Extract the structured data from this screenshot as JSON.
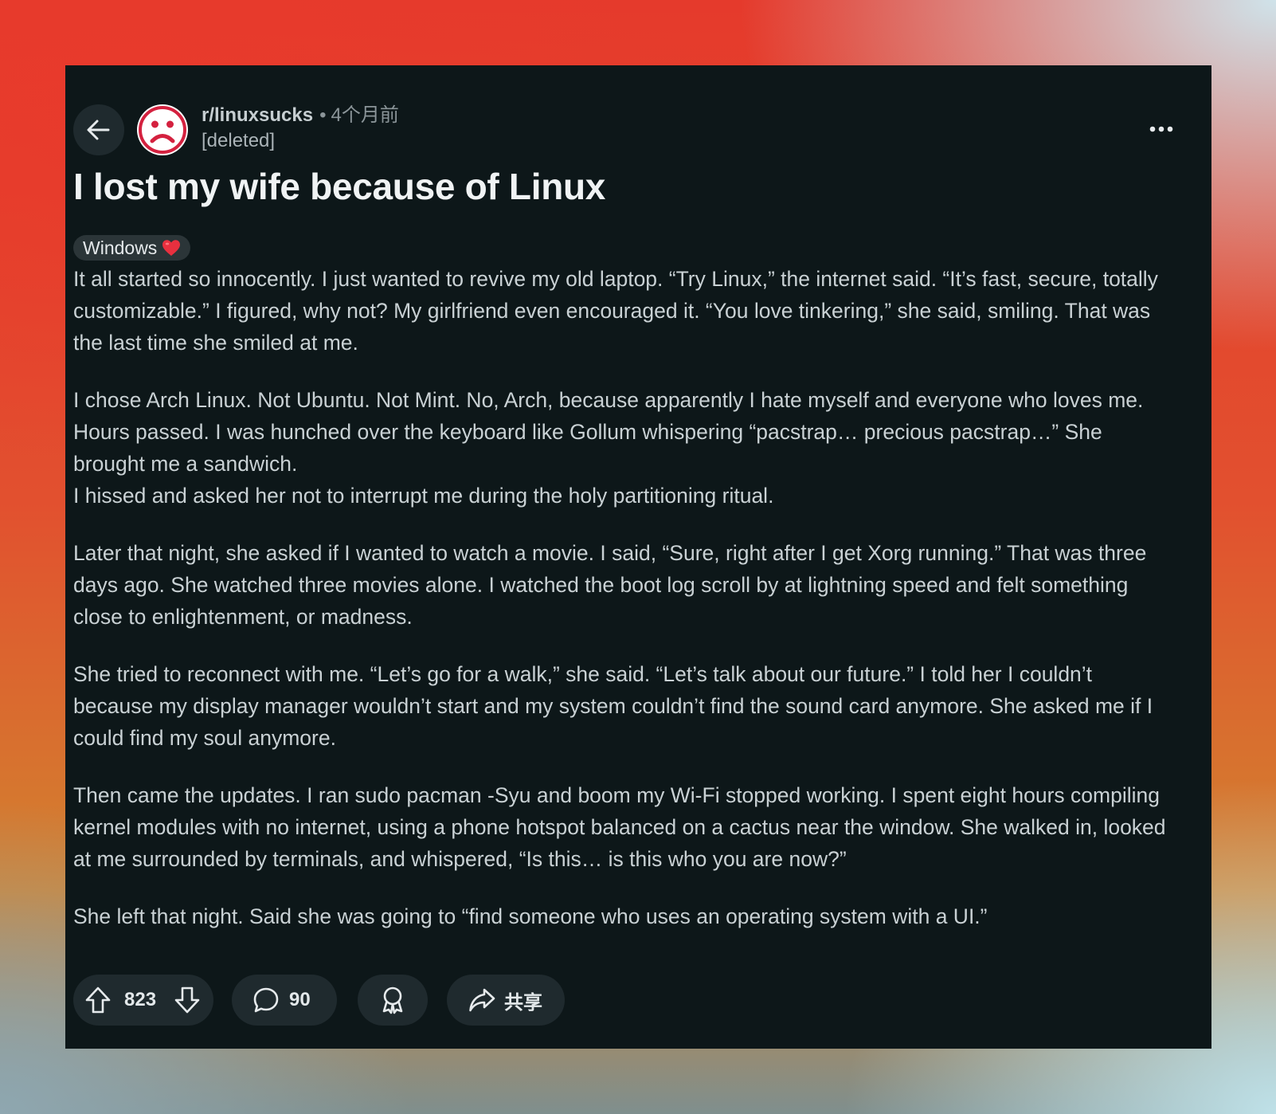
{
  "post": {
    "subreddit": "r/linuxsucks",
    "separator": "•",
    "time_ago": "4个月前",
    "author": "[deleted]",
    "title": "I lost my wife because of Linux",
    "flair": {
      "text": "Windows",
      "emoji": "❤️"
    },
    "paragraphs": [
      "It all started so innocently. I just wanted to revive my old laptop. “Try Linux,” the internet said. “It’s fast, secure, totally customizable.” I figured, why not? My girlfriend even encouraged it. “You love tinkering,” she said, smiling. That was the last time she smiled at me.",
      "I chose Arch Linux. Not Ubuntu. Not Mint. No, Arch, because apparently I hate myself and everyone who loves me. Hours passed. I was hunched over the keyboard like Gollum whispering “pacstrap… precious pacstrap…” She brought me a sandwich.",
      "I hissed and asked her not to interrupt me during the holy partitioning ritual.",
      "Later that night, she asked if I wanted to watch a movie. I said, “Sure, right after I get Xorg running.” That was three days ago. She watched three movies alone. I watched the boot log scroll by at lightning speed and felt something close to enlightenment, or madness.",
      "She tried to reconnect with me. “Let’s go for a walk,” she said. “Let’s talk about our future.” I told her I couldn’t because my display manager wouldn’t start and my system couldn’t find the sound card anymore. She asked me if I could find my soul anymore.",
      "Then came the updates. I ran sudo pacman -Syu and boom my Wi-Fi stopped working. I spent eight hours compiling kernel modules with no internet, using a phone hotspot balanced on a cactus near the window. She walked in, looked at me surrounded by terminals, and whispered, “Is this… is this who you are now?”",
      "She left that night. Said she was going to “find someone who uses an operating system with a UI.”"
    ]
  },
  "actions": {
    "votes": "823",
    "comments": "90",
    "share_label": "共享"
  },
  "icons": {
    "back": "arrow-left-icon",
    "avatar": "sad-face-icon",
    "more": "more-horizontal-icon",
    "upvote": "upvote-arrow-icon",
    "downvote": "downvote-arrow-icon",
    "comment": "comment-bubble-icon",
    "award": "award-icon",
    "share": "share-arrow-icon"
  },
  "colors": {
    "card_background": "#0d1719",
    "pill_background": "#1f2a2e",
    "avatar_red": "#d4213f",
    "flair_background": "#2b3538"
  }
}
